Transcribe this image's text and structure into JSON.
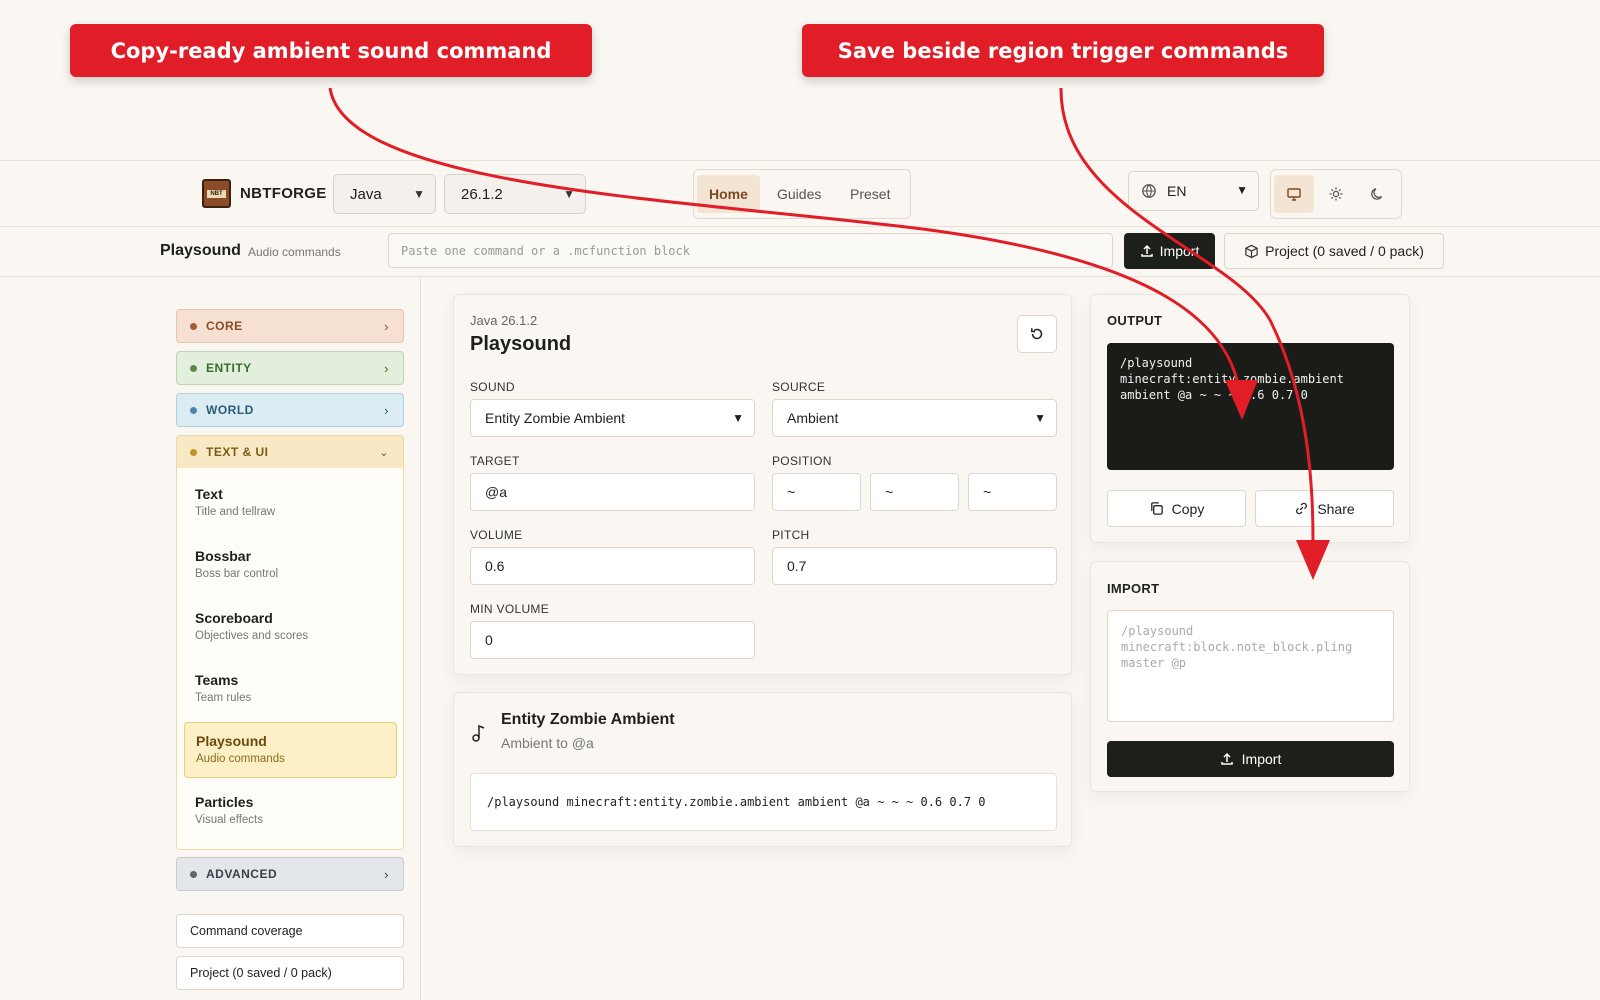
{
  "annotations": {
    "left": "Copy-ready ambient sound command",
    "right": "Save beside region trigger commands"
  },
  "header": {
    "brand": "NBTFORGE",
    "logo_text": "NBT",
    "edition": "Java",
    "version": "26.1.2",
    "nav": [
      "Home",
      "Guides",
      "Preset"
    ],
    "language": "EN"
  },
  "subbar": {
    "title": "Playsound",
    "subtitle": "Audio commands",
    "paste_placeholder": "Paste one command or a .mcfunction block",
    "import_label": "Import",
    "project_label": "Project (0 saved / 0 pack)"
  },
  "sidebar": {
    "categories": [
      {
        "label": "CORE",
        "color": "#f6e0d2",
        "dot": "#a55a35"
      },
      {
        "label": "ENTITY",
        "color": "#e2efdc",
        "dot": "#5a8a4a"
      },
      {
        "label": "WORLD",
        "color": "#dcecf3",
        "dot": "#4a86a8"
      },
      {
        "label": "TEXT & UI",
        "color": "#f8e9c4",
        "dot": "#c4902a"
      },
      {
        "label": "ADVANCED",
        "color": "#e4e7ea",
        "dot": "#5c6570"
      }
    ],
    "items": [
      {
        "name": "Text",
        "desc": "Title and tellraw"
      },
      {
        "name": "Bossbar",
        "desc": "Boss bar control"
      },
      {
        "name": "Scoreboard",
        "desc": "Objectives and scores"
      },
      {
        "name": "Teams",
        "desc": "Team rules"
      },
      {
        "name": "Playsound",
        "desc": "Audio commands"
      },
      {
        "name": "Particles",
        "desc": "Visual effects"
      }
    ],
    "coverage": "Command coverage",
    "project": "Project (0 saved / 0 pack)"
  },
  "editor": {
    "edition_version": "Java 26.1.2",
    "title": "Playsound",
    "labels": {
      "sound": "SOUND",
      "source": "SOURCE",
      "target": "TARGET",
      "position": "POSITION",
      "volume": "VOLUME",
      "pitch": "PITCH",
      "min_volume": "MIN VOLUME"
    },
    "values": {
      "sound": "Entity Zombie Ambient",
      "source": "Ambient",
      "target": "@a",
      "pos_x": "~",
      "pos_y": "~",
      "pos_z": "~",
      "volume": "0.6",
      "pitch": "0.7",
      "min_volume": "0"
    }
  },
  "summary": {
    "title": "Entity Zombie Ambient",
    "subtitle": "Ambient to @a",
    "command": "/playsound minecraft:entity.zombie.ambient ambient @a ~ ~ ~ 0.6 0.7 0"
  },
  "output": {
    "label": "OUTPUT",
    "line1": "/playsound",
    "line2": "minecraft:entity.zombie.ambient",
    "line3": "ambient @a ~ ~ ~ 0.6 0.7 0",
    "copy": "Copy",
    "share": "Share"
  },
  "import_panel": {
    "label": "IMPORT",
    "placeholder_line1": "/playsound",
    "placeholder_line2": "minecraft:block.note_block.pling",
    "placeholder_line3": "master @p",
    "button": "Import"
  },
  "colors": {
    "callout": "#e11d27",
    "accent_dark": "#1d1f1a",
    "active_tab": "#f3e4d4"
  }
}
